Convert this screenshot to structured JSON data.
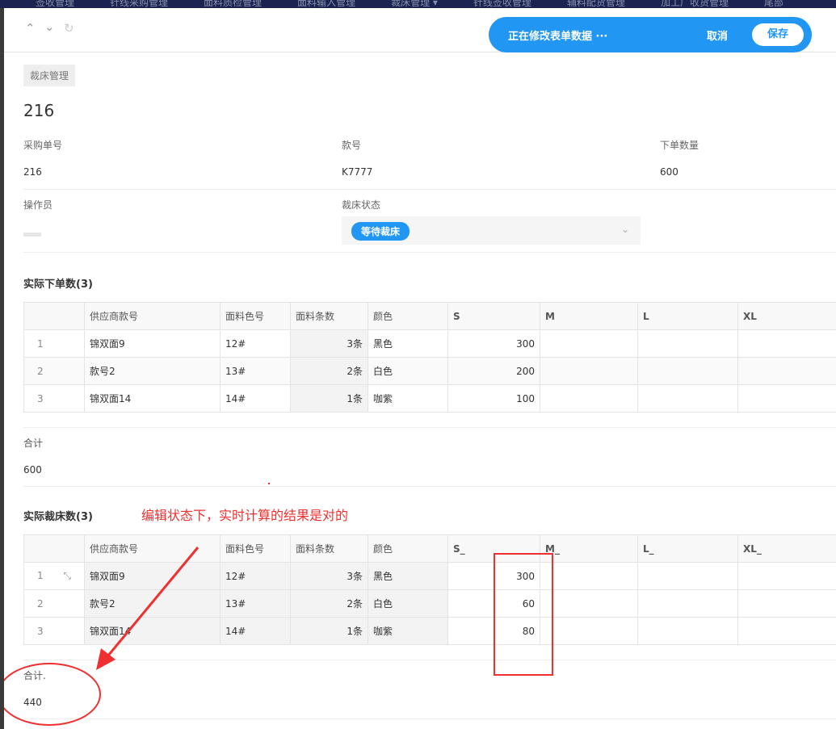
{
  "topnav": [
    "签收管理",
    "针线采购管理",
    "面料质检管理",
    "面料输入管理",
    "裁床管理 ▾",
    "针线签收管理",
    "辅料配货管理",
    "加工厂收货管理",
    "尾部"
  ],
  "banner": {
    "message": "正在修改表单数据 ···",
    "cancel": "取消",
    "save": "保存"
  },
  "breadcrumb": "裁床管理",
  "title": "216",
  "fields": {
    "po_label": "采购单号",
    "po": "216",
    "style_label": "款号",
    "style": "K7777",
    "qty_label": "下单数量",
    "qty": "600",
    "operator_label": "操作员",
    "status_label": "裁床状态",
    "status": "等待裁床"
  },
  "table1": {
    "title": "实际下单数(3)",
    "headers": [
      "",
      "供应商款号",
      "面料色号",
      "面料条数",
      "颜色",
      "S",
      "M",
      "L",
      "XL"
    ],
    "rows": [
      [
        "1",
        "锦双面9",
        "12#",
        "3条",
        "黑色",
        "300",
        "",
        "",
        ""
      ],
      [
        "2",
        "款号2",
        "13#",
        "2条",
        "白色",
        "200",
        "",
        "",
        ""
      ],
      [
        "3",
        "锦双面14",
        "14#",
        "1条",
        "咖紫",
        "100",
        "",
        "",
        ""
      ]
    ],
    "sum_label": "合计",
    "sum": "600"
  },
  "table2": {
    "title": "实际裁床数(3)",
    "headers": [
      "",
      "供应商款号",
      "面料色号",
      "面料条数",
      "颜色",
      "S_",
      "M_",
      "L_",
      "XL_"
    ],
    "rows": [
      [
        "1",
        "锦双面9",
        "12#",
        "3条",
        "黑色",
        "300",
        "",
        "",
        ""
      ],
      [
        "2",
        "款号2",
        "13#",
        "2条",
        "白色",
        "60",
        "",
        "",
        ""
      ],
      [
        "3",
        "锦双面14",
        "14#",
        "1条",
        "咖紫",
        "80",
        "",
        "",
        ""
      ]
    ],
    "sum_label": "合计.",
    "sum": "440"
  },
  "annotation": "编辑状态下，实时计算的结果是对的",
  "colors": {
    "accent": "#2196f3",
    "annotation": "#f03030"
  }
}
